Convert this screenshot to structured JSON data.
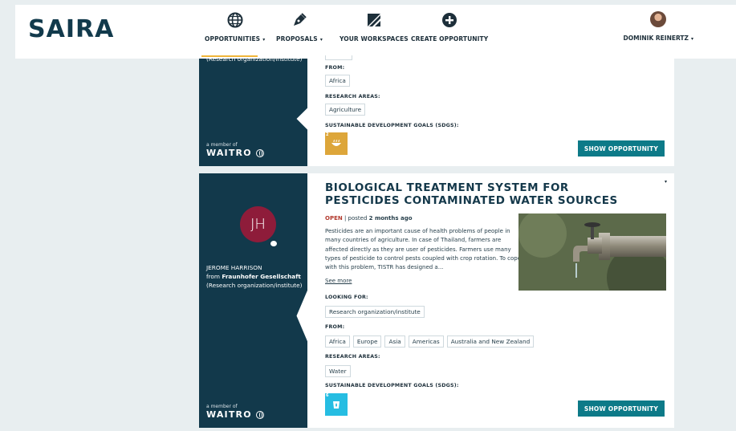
{
  "header": {
    "logo": "SAIRA",
    "nav": [
      {
        "label": "OPPORTUNITIES",
        "icon": "globe-icon",
        "has_caret": true
      },
      {
        "label": "PROPOSALS",
        "icon": "pen-icon",
        "has_caret": true
      },
      {
        "label": "YOUR WORKSPACES",
        "icon": "workspace-icon",
        "has_caret": false
      },
      {
        "label": "CREATE OPPORTUNITY",
        "icon": "plus-circle-icon",
        "has_caret": false
      }
    ],
    "user_name": "DOMINIK REINERTZ",
    "caret": "▾",
    "accent_color": "#f0b53a"
  },
  "cards": [
    {
      "org_type": "(Research organization/institute)",
      "member_of": "a member of",
      "member_org": "WAITRO",
      "from_label": "FROM:",
      "from": [
        "Africa"
      ],
      "research_label": "RESEARCH AREAS:",
      "research": [
        "Agriculture"
      ],
      "sdg_label": "SUSTAINABLE DEVELOPMENT GOALS (SDGS):",
      "sdg": "2",
      "button": "SHOW OPPORTUNITY"
    },
    {
      "initials": "JH",
      "author": "JEROME HARRISON",
      "from_word": "from",
      "org_name": "Fraunhofer Gesellschaft",
      "org_type": "(Research organization/institute)",
      "member_of": "a member of",
      "member_org": "WAITRO",
      "title": "BIOLOGICAL TREATMENT SYSTEM FOR PESTICIDES CONTAMINATED WATER SOURCES",
      "status": "OPEN",
      "posted_prefix": " | posted ",
      "posted_ago": "2 months ago",
      "description": "Pesticides are an important cause of health problems of people in many countries of agriculture. In case of Thailand, farmers are affected directly as they are user of pesticides. Farmers use many types of pesticide to control pests coupled with crop rotation. To cope with this problem, TISTR has designed a...",
      "see_more": "See more",
      "looking_label": "LOOKING FOR:",
      "looking": [
        "Research organization/institute"
      ],
      "from_label": "FROM:",
      "from": [
        "Africa",
        "Europe",
        "Asia",
        "Americas",
        "Australia and New Zealand"
      ],
      "research_label": "RESEARCH AREAS:",
      "research": [
        "Water"
      ],
      "sdg_label": "SUSTAINABLE DEVELOPMENT GOALS (SDGS):",
      "sdg": "6",
      "button": "SHOW OPPORTUNITY",
      "avatar_color": "#8e1c3a"
    }
  ]
}
